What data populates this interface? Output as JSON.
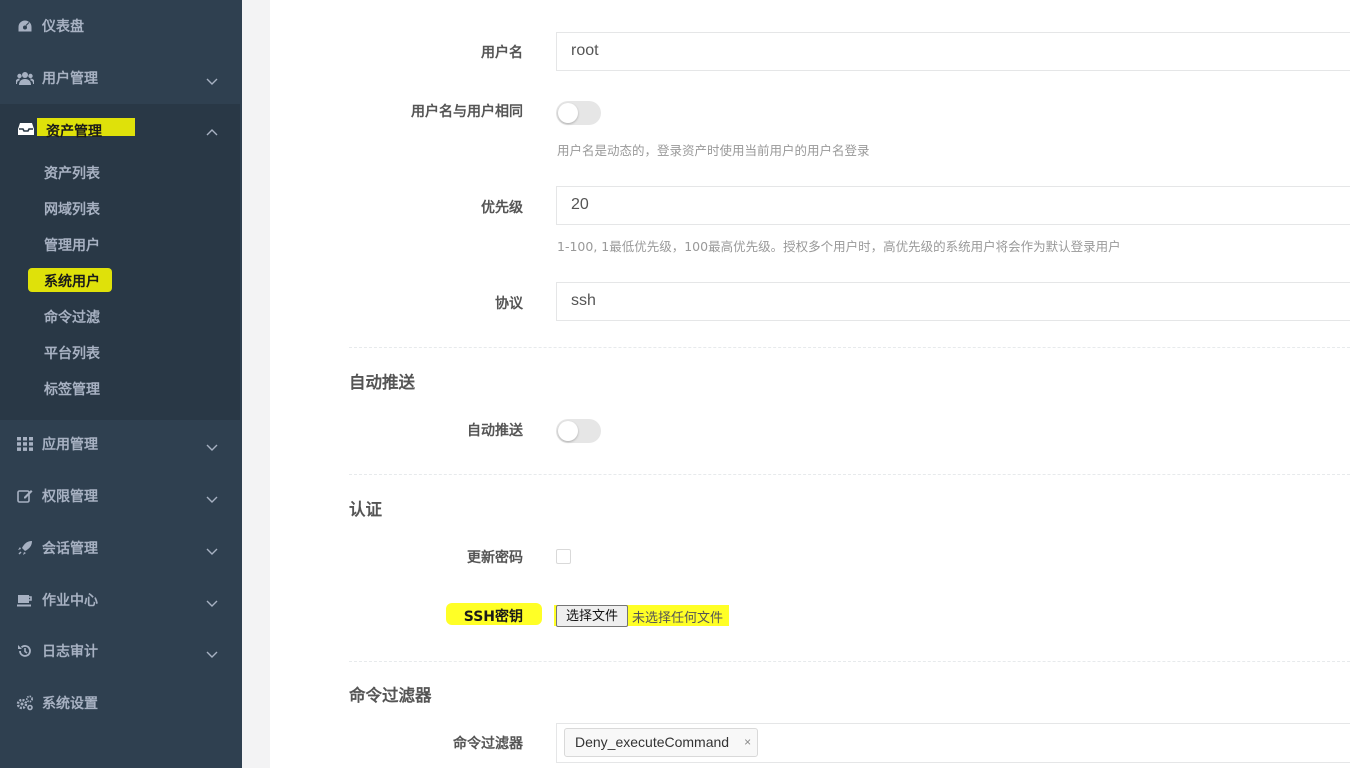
{
  "sidebar": {
    "items": [
      {
        "label": "仪表盘",
        "icon": "dashboard-icon",
        "has_chevron": false
      },
      {
        "label": "用户管理",
        "icon": "users-icon",
        "has_chevron": true
      },
      {
        "label": "资产管理",
        "icon": "inbox-icon",
        "has_chevron": true,
        "expanded": true
      },
      {
        "label": "应用管理",
        "icon": "grid-icon",
        "has_chevron": true
      },
      {
        "label": "权限管理",
        "icon": "edit-icon",
        "has_chevron": true
      },
      {
        "label": "会话管理",
        "icon": "rocket-icon",
        "has_chevron": true
      },
      {
        "label": "作业中心",
        "icon": "coffee-icon",
        "has_chevron": true
      },
      {
        "label": "日志审计",
        "icon": "history-icon",
        "has_chevron": true
      },
      {
        "label": "系统设置",
        "icon": "gears-icon",
        "has_chevron": false
      }
    ],
    "asset_sub_items": [
      {
        "label": "资产列表"
      },
      {
        "label": "网域列表"
      },
      {
        "label": "管理用户"
      },
      {
        "label": "系统用户",
        "highlighted": true
      },
      {
        "label": "命令过滤"
      },
      {
        "label": "平台列表"
      },
      {
        "label": "标签管理"
      }
    ]
  },
  "form": {
    "username_label": "用户名",
    "username_value": "root",
    "username_same_label": "用户名与用户相同",
    "username_same_help": "用户名是动态的，登录资产时使用当前用户的用户名登录",
    "priority_label": "优先级",
    "priority_value": "20",
    "priority_help": "1-100, 1最低优先级，100最高优先级。授权多个用户时，高优先级的系统用户将会作为默认登录用户",
    "protocol_label": "协议",
    "protocol_value": "ssh",
    "section_auto_push": "自动推送",
    "auto_push_label": "自动推送",
    "section_auth": "认证",
    "update_password_label": "更新密码",
    "ssh_key_label": "SSH密钥",
    "file_button_label": "选择文件",
    "file_none_text": "未选择任何文件",
    "section_cmd_filter": "命令过滤器",
    "cmd_filter_label": "命令过滤器",
    "cmd_filter_tag": "Deny_executeCommand",
    "cmd_filter_tag_remove": "×"
  },
  "colors": {
    "sidebar_bg": "#2f4050",
    "sidebar_active_bg": "#293846",
    "highlight": "#ffff00"
  }
}
